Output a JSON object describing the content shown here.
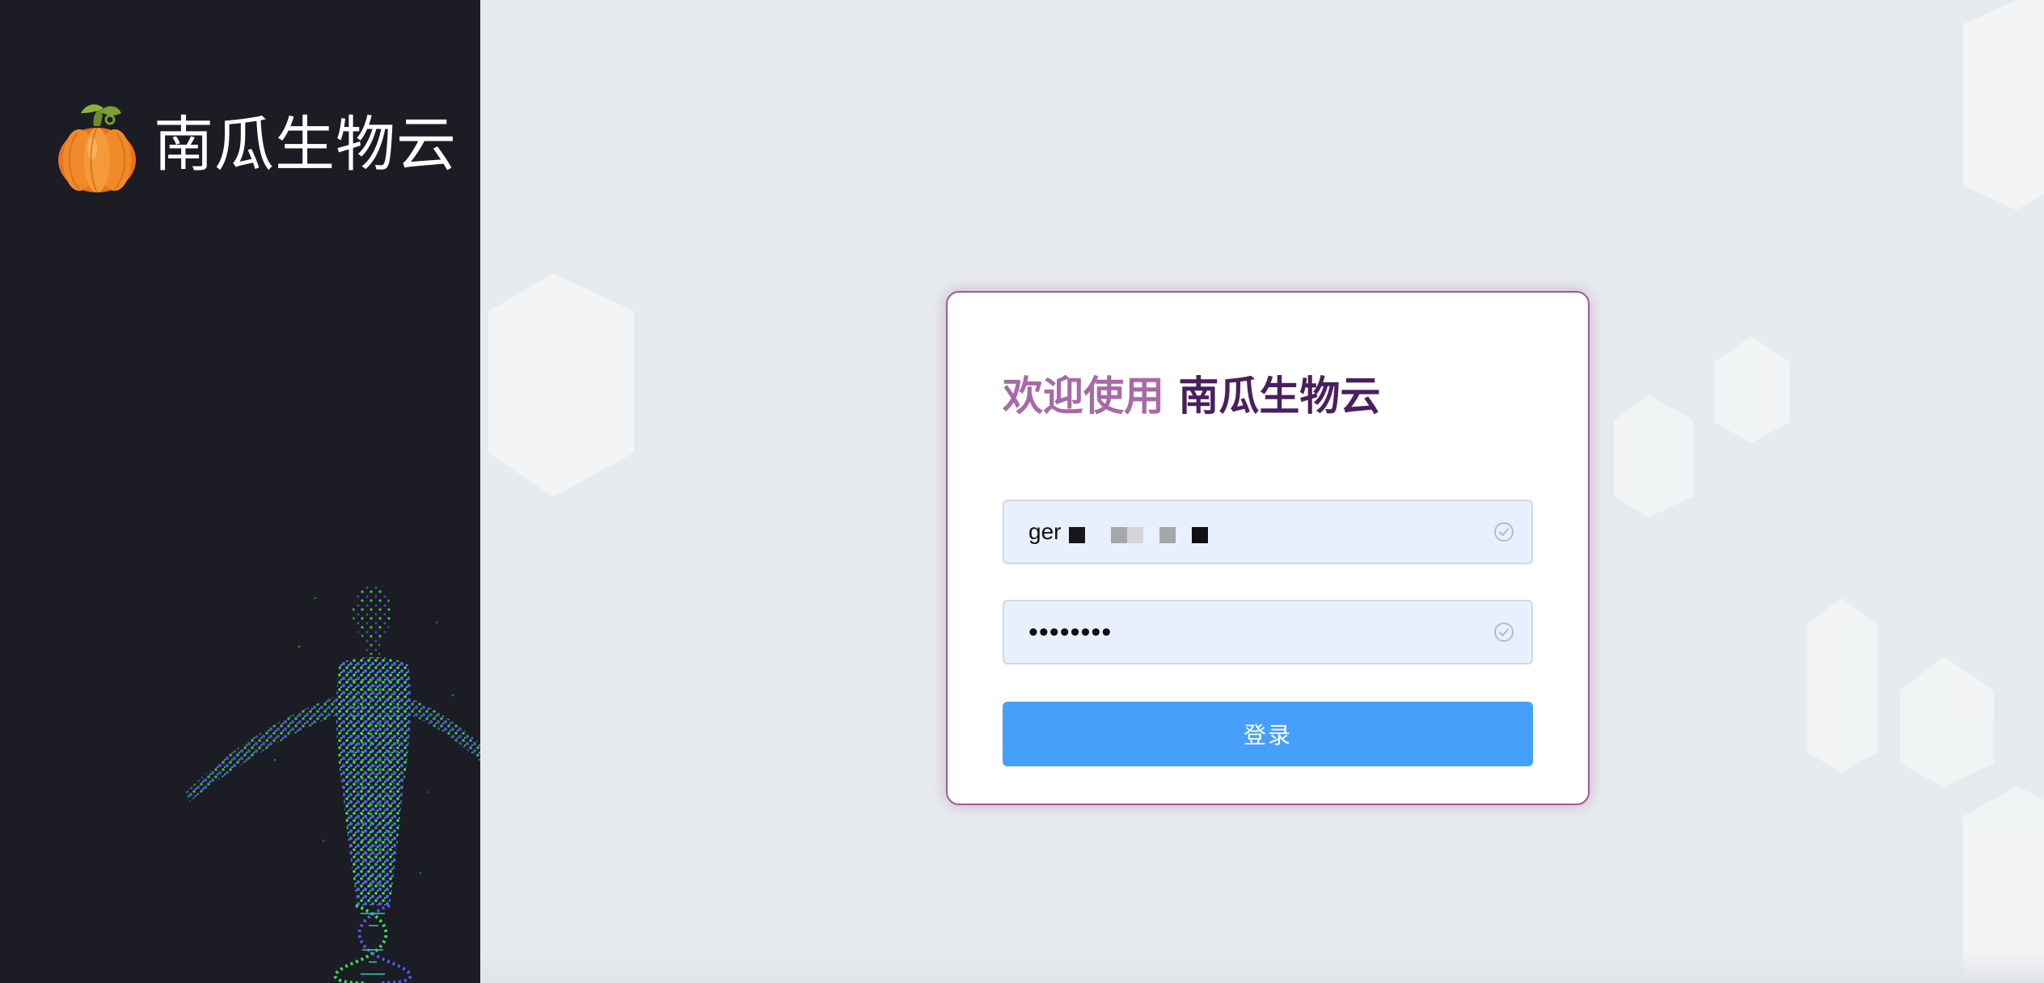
{
  "brand": {
    "name": "南瓜生物云",
    "logo_icon": "pumpkin-icon"
  },
  "login": {
    "welcome_prefix": "欢迎使用",
    "welcome_brand": "南瓜生物云",
    "username_value": "ger",
    "password_value": "••••••••",
    "submit_label": "登录",
    "field_status_icon": "check-circle-icon"
  },
  "colors": {
    "sidebar_bg": "#1b1c24",
    "page_bg": "#e7ebee",
    "card_border": "#9b5b93",
    "button_bg": "#46a0fa",
    "input_bg": "#e8f0fe",
    "welcome_light": "#a86aa6",
    "welcome_strong": "#4a1f5e"
  }
}
